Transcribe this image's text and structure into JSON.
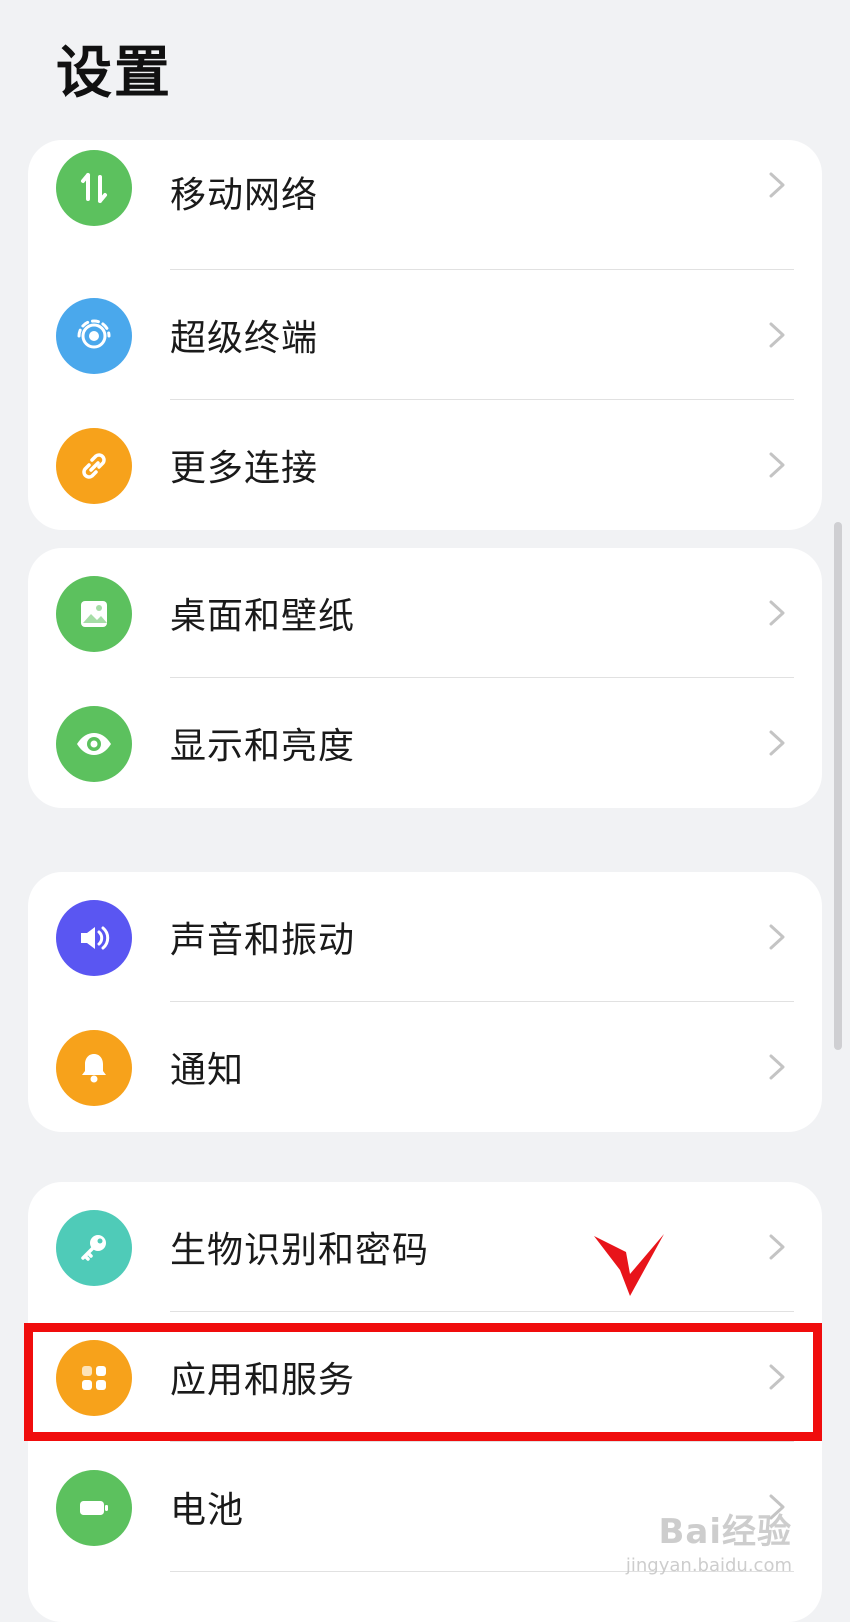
{
  "header": {
    "title": "设置"
  },
  "groups": [
    {
      "items": [
        {
          "label": "移动网络",
          "icon": "mobile-data-icon",
          "color": "#5cc15e"
        },
        {
          "label": "超级终端",
          "icon": "super-device-icon",
          "color": "#4aa8ec"
        },
        {
          "label": "更多连接",
          "icon": "link-icon",
          "color": "#f7a21b"
        }
      ]
    },
    {
      "items": [
        {
          "label": "桌面和壁纸",
          "icon": "wallpaper-icon",
          "color": "#5cc15e"
        },
        {
          "label": "显示和亮度",
          "icon": "eye-icon",
          "color": "#5cc15e"
        }
      ]
    },
    {
      "items": [
        {
          "label": "声音和振动",
          "icon": "speaker-icon",
          "color": "#5a56f2"
        },
        {
          "label": "通知",
          "icon": "bell-icon",
          "color": "#f7a21b"
        }
      ]
    },
    {
      "items": [
        {
          "label": "生物识别和密码",
          "icon": "key-icon",
          "color": "#4fcbb8"
        },
        {
          "label": "应用和服务",
          "icon": "apps-icon",
          "color": "#f7a21b"
        },
        {
          "label": "电池",
          "icon": "battery-icon",
          "color": "#5cc15e"
        }
      ]
    }
  ],
  "annotation": {
    "highlight_color": "#f00d0d"
  },
  "watermark": {
    "main": "Bai经验",
    "sub": "jingyan.baidu.com"
  }
}
